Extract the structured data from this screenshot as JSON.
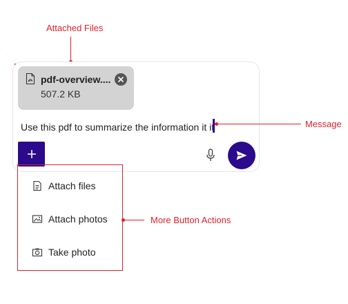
{
  "annotations": {
    "attached_files": "Attached Files",
    "message": "Message",
    "more_button_actions": "More Button Actions"
  },
  "composer": {
    "attachment": {
      "file_name": "pdf-overview....",
      "file_size": "507.2 KB",
      "icon": "pdf-file-icon",
      "remove_icon": "close-icon"
    },
    "message_text": "Use this pdf to summarize the information it it",
    "more_button_icon": "plus-icon",
    "mic_icon": "microphone-icon",
    "send_icon": "send-icon"
  },
  "more_menu": {
    "items": [
      {
        "label": "Attach files",
        "icon": "document-icon"
      },
      {
        "label": "Attach photos",
        "icon": "image-icon"
      },
      {
        "label": "Take photo",
        "icon": "camera-icon"
      }
    ]
  },
  "colors": {
    "accent": "#2b0a8c",
    "annotation": "#e0202a",
    "chip_background": "#d3d3d3"
  }
}
